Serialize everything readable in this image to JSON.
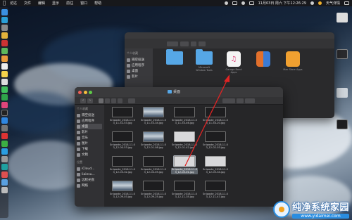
{
  "menubar": {
    "items": [
      "访达",
      "文件",
      "编辑",
      "显示",
      "前往",
      "窗口",
      "帮助"
    ],
    "clock": "11月03日 周六 下午12:26:29",
    "weather": "天气详情"
  },
  "back_window": {
    "sidebar": {
      "section": "个人收藏",
      "items": [
        "隔空投送",
        "应用程序",
        "桌面",
        "影片"
      ]
    },
    "files": [
      {
        "label": "",
        "kind": "folder"
      },
      {
        "label": "Microsoft Window Tools",
        "kind": "folder"
      },
      {
        "label": "Garage Band Apps",
        "kind": "itunes"
      },
      {
        "label": "",
        "kind": "books"
      },
      {
        "label": "Mac Store Apps",
        "kind": "app"
      }
    ]
  },
  "front_window": {
    "title": "桌面",
    "sidebar": {
      "favorites_header": "个人收藏",
      "favorites": [
        "隔空投送",
        "应用程序",
        "桌面",
        "影片",
        "音乐",
        "图片",
        "下载",
        "文稿"
      ],
      "places_header": "位置",
      "places": [
        "iCloud...",
        "liaiesu...",
        "远程光盘",
        "网络"
      ]
    },
    "rows": [
      [
        "Snipaste_2018-11-03_11-52-53.jpg",
        "Snipaste_2018-11-03_11-53-34.jpg",
        "Snipaste_2018-11-03_11-53-46.jpg",
        "Snipaste_2018-11-03_11-54-20.jpg"
      ],
      [
        "Snipaste_2018-11-03_12-00-53.jpg",
        "Snipaste_2018-11-03_12-01-08.jpg",
        "Snipaste_2018-11-03_12-01-42.jpg",
        "Snipaste_2018-11-03_12-02-03.jpg"
      ],
      [
        "Snipaste_2018-11-03_12-03-32.jpg",
        "Snipaste_2018-11-03_12-04-05.jpg",
        "Snipaste_2018-11-03_12-05-01.jpg",
        "Snipaste_2018-11-03_12-05-34.jpg"
      ],
      [
        "Snipaste_2018-11-03_12-09-03.jpg",
        "Snipaste_2018-11-03_12-09-25.jpg",
        "Snipaste_2018-11-03_12-11-35.jpg",
        "Snipaste_2018-11-03_12-11-47.jpg"
      ]
    ],
    "selected_file": "Snipaste_2018-11-03_12-05-01.jpg"
  },
  "watermark": {
    "title": "纯净系统家园",
    "url": "www.yidaimei.com"
  }
}
